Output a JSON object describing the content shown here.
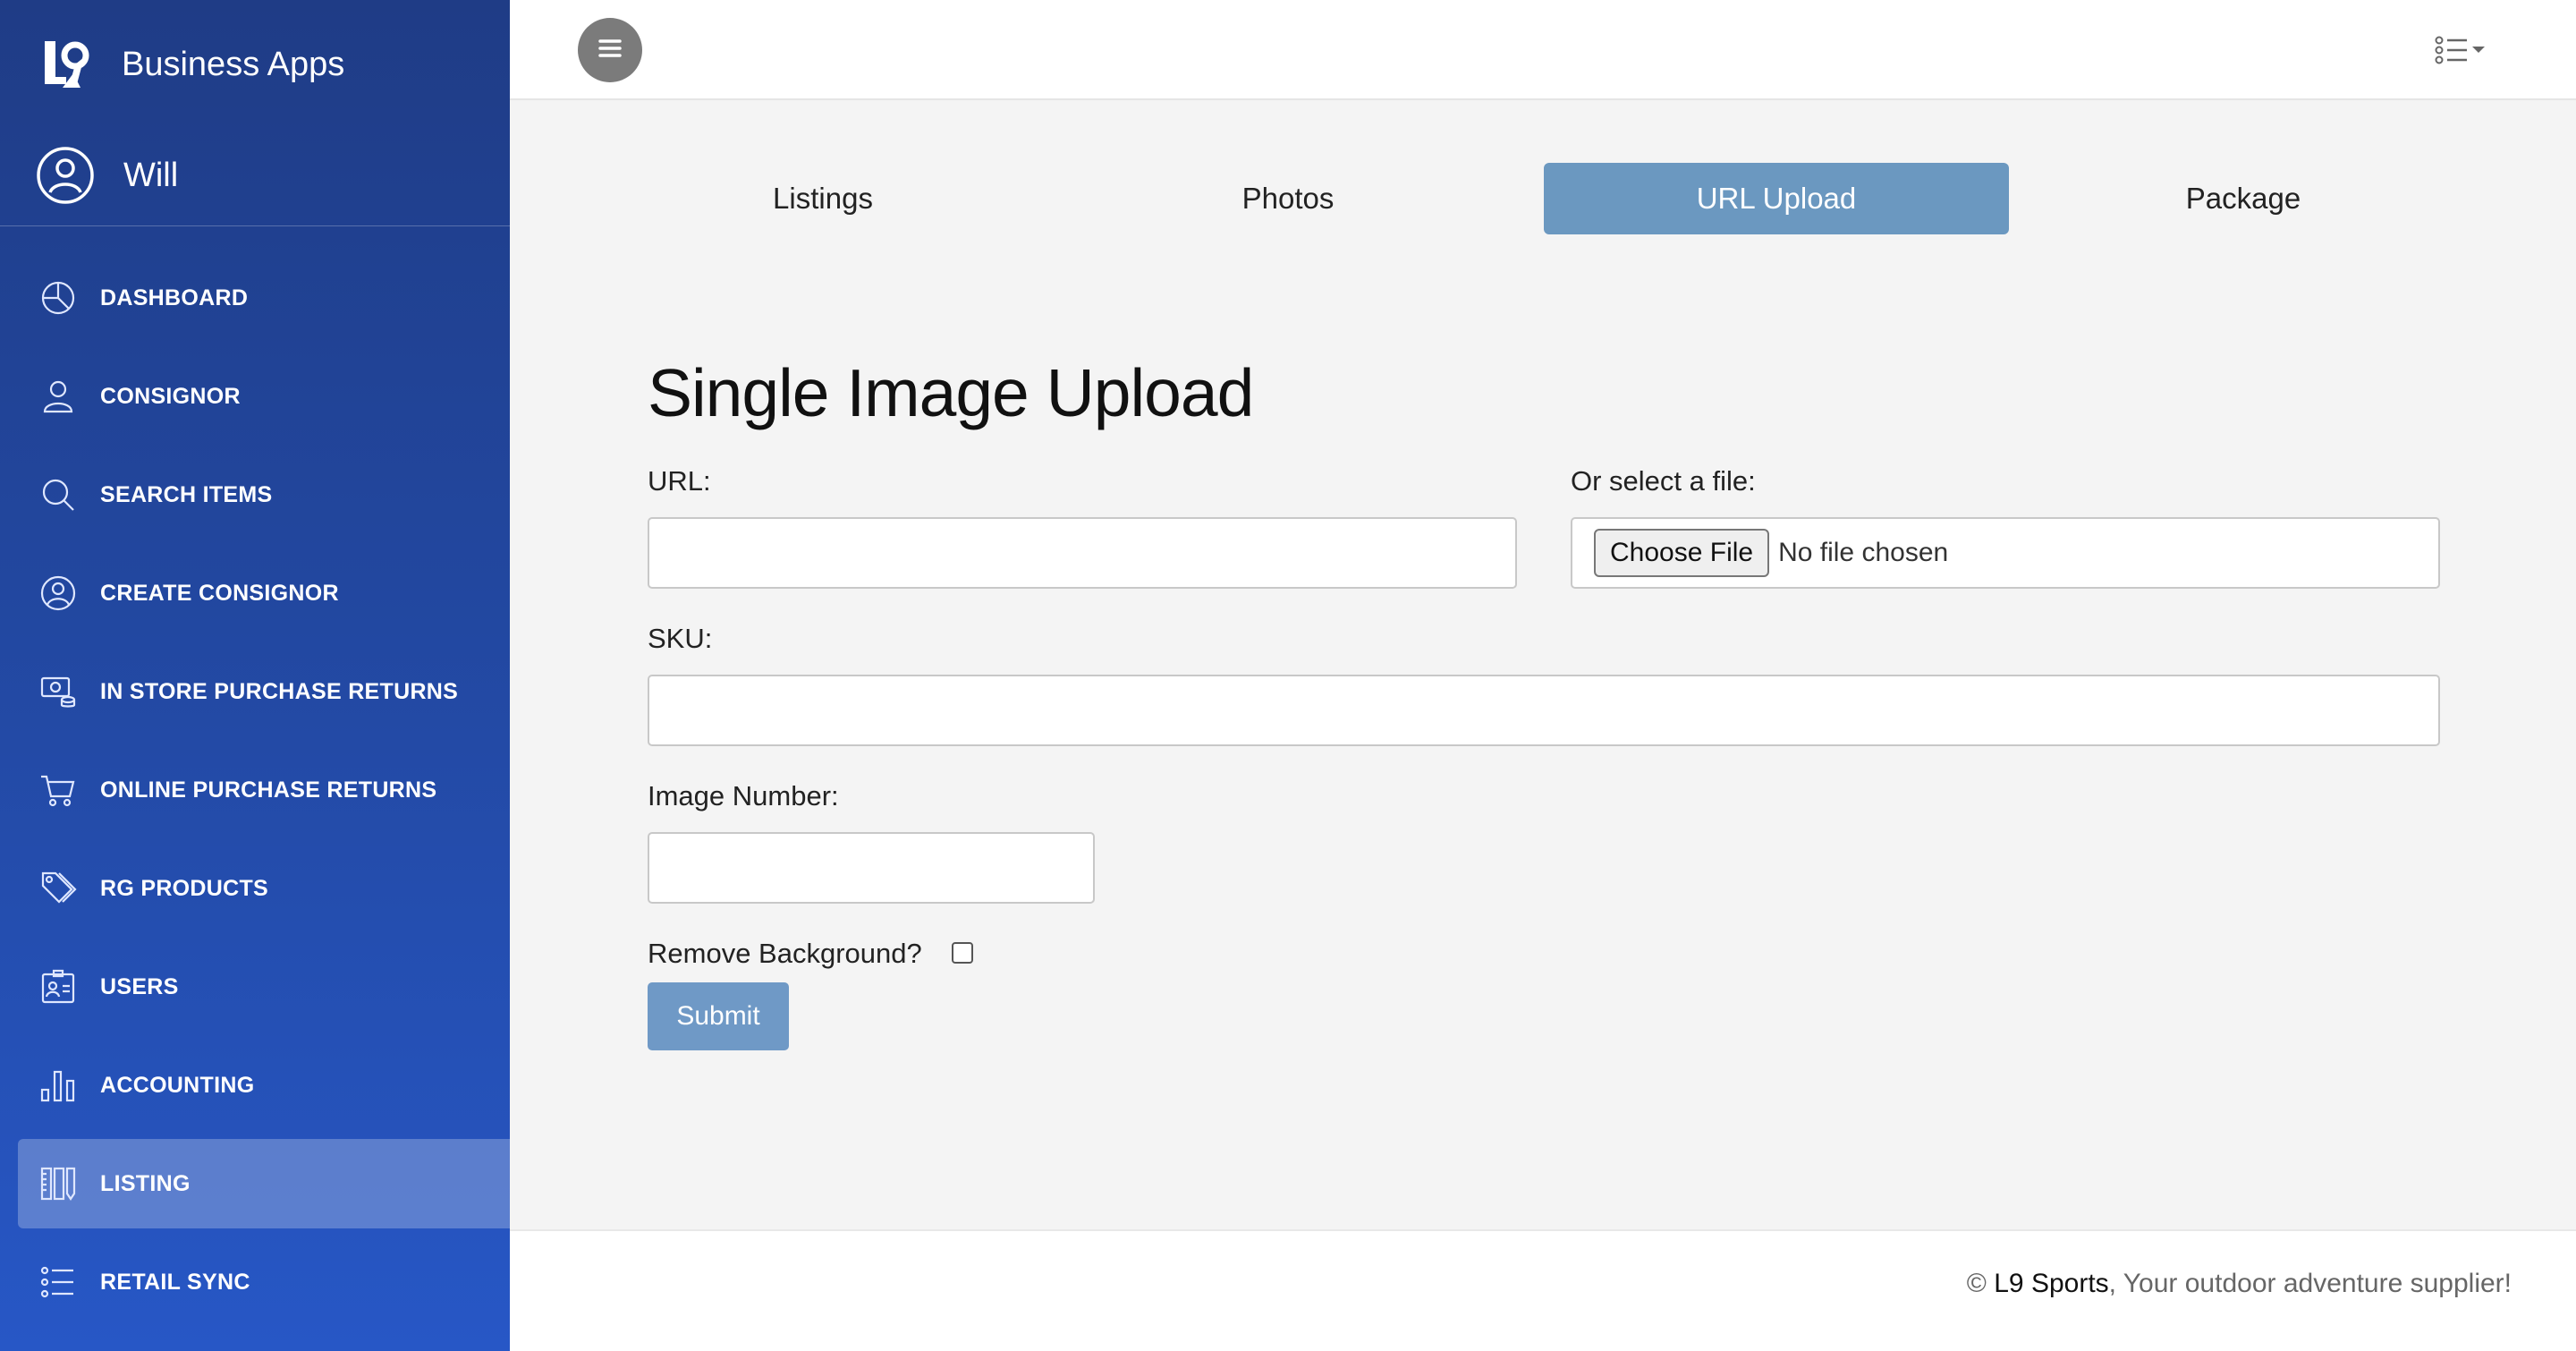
{
  "sidebar": {
    "brand": "Business Apps",
    "user": "Will",
    "items": [
      {
        "label": "DASHBOARD",
        "icon": "pie-chart-icon"
      },
      {
        "label": "CONSIGNOR",
        "icon": "person-icon"
      },
      {
        "label": "SEARCH ITEMS",
        "icon": "search-icon"
      },
      {
        "label": "CREATE CONSIGNOR",
        "icon": "person-circle-icon"
      },
      {
        "label": "IN STORE PURCHASE RETURNS",
        "icon": "cash-coins-icon"
      },
      {
        "label": "ONLINE PURCHASE RETURNS",
        "icon": "cart-icon"
      },
      {
        "label": "RG PRODUCTS",
        "icon": "tags-icon"
      },
      {
        "label": "USERS",
        "icon": "person-badge-icon"
      },
      {
        "label": "ACCOUNTING",
        "icon": "bar-chart-icon"
      },
      {
        "label": "LISTING",
        "icon": "rulers-icon",
        "active": true
      },
      {
        "label": "RETAIL SYNC",
        "icon": "list-icon"
      }
    ]
  },
  "topbar": {
    "menu_toggle_icon": "hamburger-icon",
    "list_menu_icon": "list-dropdown-icon"
  },
  "tabs": [
    {
      "label": "Listings"
    },
    {
      "label": "Photos"
    },
    {
      "label": "URL Upload",
      "active": true
    },
    {
      "label": "Package"
    }
  ],
  "form": {
    "title": "Single Image Upload",
    "url_label": "URL:",
    "url_value": "",
    "file_label": "Or select a file:",
    "file_button": "Choose File",
    "file_status": "No file chosen",
    "sku_label": "SKU:",
    "sku_value": "",
    "image_number_label": "Image Number:",
    "image_number_value": "",
    "remove_bg_label": "Remove Background?",
    "remove_bg_checked": false,
    "submit_label": "Submit"
  },
  "footer": {
    "prefix": "© ",
    "brand": "L9 Sports",
    "tagline": ", Your outdoor adventure supplier!"
  },
  "colors": {
    "sidebar_top": "#1f3c86",
    "sidebar_bottom": "#2757c6",
    "tab_active": "#6b98c0",
    "submit": "#6f99c6"
  }
}
